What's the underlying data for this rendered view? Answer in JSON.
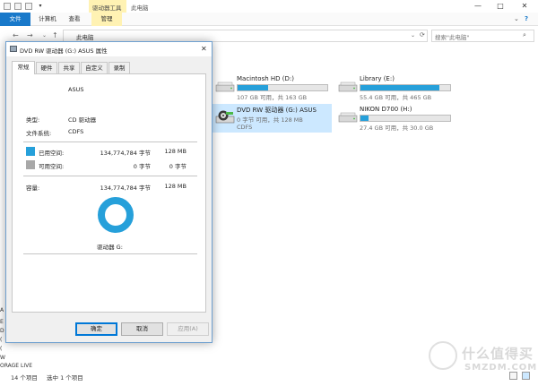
{
  "explorer": {
    "context_group": "驱动器工具",
    "title": "此电脑",
    "window_buttons": {
      "minimize": "—",
      "maximize": "□",
      "close": "✕"
    },
    "tabs": [
      {
        "label": "文件"
      },
      {
        "label": "计算机"
      },
      {
        "label": "查看"
      },
      {
        "label": "管理"
      }
    ],
    "ribbon_expand": "⌄",
    "help": "?",
    "nav": {
      "back": "←",
      "forward": "→",
      "up": "↑",
      "refresh": "⟳",
      "dropdown": "⌄"
    },
    "address": "此电脑",
    "search_placeholder": "搜索\"此电脑\"",
    "search_icon": "⌕",
    "drives": [
      {
        "name": "Macintosh HD (D:)",
        "info": "107 GB 可用，共 163 GB",
        "fill": 0.34,
        "selected": false
      },
      {
        "name": "Library (E:)",
        "info": "55.4 GB 可用，共 465 GB",
        "fill": 0.88,
        "selected": false
      },
      {
        "name": "DVD RW 驱动器 (G:) ASUS",
        "info": "0 字节 可用，共 128 MB",
        "sub": "CDFS",
        "fill": 1.0,
        "selected": true
      },
      {
        "name": "NIKON D700 (H:)",
        "info": "27.4 GB 可用，共 30.0 GB",
        "fill": 0.09,
        "selected": false
      }
    ],
    "left_fragments": [
      "A",
      "E",
      "D",
      "(",
      "(",
      "W",
      "ORAGE LIVE"
    ],
    "status_count": "14 个项目",
    "status_selected": "选中 1 个项目"
  },
  "dialog": {
    "title": "DVD RW 驱动器 (G:) ASUS 属性",
    "close": "✕",
    "tabs": [
      {
        "label": "常规"
      },
      {
        "label": "硬件"
      },
      {
        "label": "共享"
      },
      {
        "label": "自定义"
      },
      {
        "label": "录制"
      }
    ],
    "drive_label": "ASUS",
    "type_label": "类型:",
    "type_value": "CD 驱动器",
    "fs_label": "文件系统:",
    "fs_value": "CDFS",
    "used_label": "已用空间:",
    "used_bytes": "134,774,784 字节",
    "used_size": "128 MB",
    "free_label": "可用空间:",
    "free_bytes": "0 字节",
    "free_size": "0 字节",
    "capacity_label": "容量:",
    "capacity_bytes": "134,774,784 字节",
    "capacity_size": "128 MB",
    "used_fraction": 1.0,
    "used_color": "#26a0da",
    "free_color": "#a8a8a8",
    "donut_caption": "驱动器 G:",
    "buttons": {
      "ok": "确定",
      "cancel": "取消",
      "apply": "应用(A)"
    }
  },
  "watermark": {
    "text": "什么值得买",
    "sub": "SMZDM.COM"
  }
}
